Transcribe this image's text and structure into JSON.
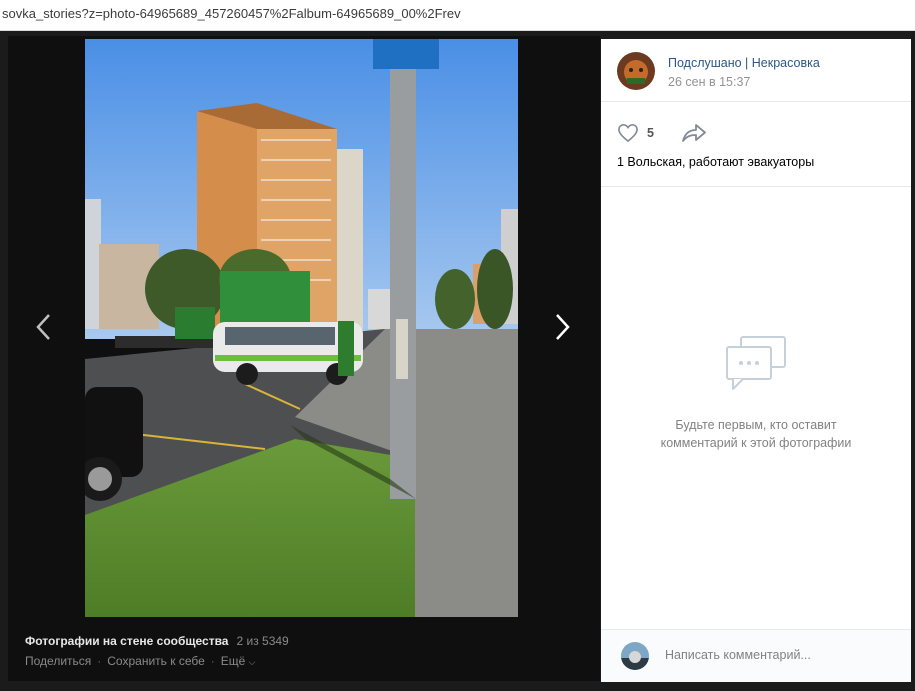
{
  "browser": {
    "url": "sovka_stories?z=photo-64965689_457260457%2Falbum-64965689_00%2Frev"
  },
  "viewer": {
    "album_label": "Фотографии на стене сообщества",
    "counter": "2 из 5349",
    "share_label": "Поделиться",
    "save_label": "Сохранить к себе",
    "more_label": "Ещё",
    "separator": "·"
  },
  "post": {
    "author": "Подслушано | Некрасовка",
    "date": "26 сен в 15:37",
    "likes": "5",
    "caption": "1 Вольская, работают эвакуаторы"
  },
  "comments": {
    "empty_line1": "Будьте первым, кто оставит",
    "empty_line2": "комментарий к этой фотографии",
    "input_placeholder": "Написать комментарий..."
  },
  "colors": {
    "link": "#2a5885",
    "muted": "#828282",
    "viewer_bg": "#1b1b1b",
    "panel_bg": "#ffffff"
  },
  "icons": {
    "prev": "chevron-left-icon",
    "next": "chevron-right-icon",
    "like": "heart-icon",
    "share": "share-arrow-icon",
    "empty": "comment-bubble-icon",
    "more": "chevron-down-icon"
  }
}
